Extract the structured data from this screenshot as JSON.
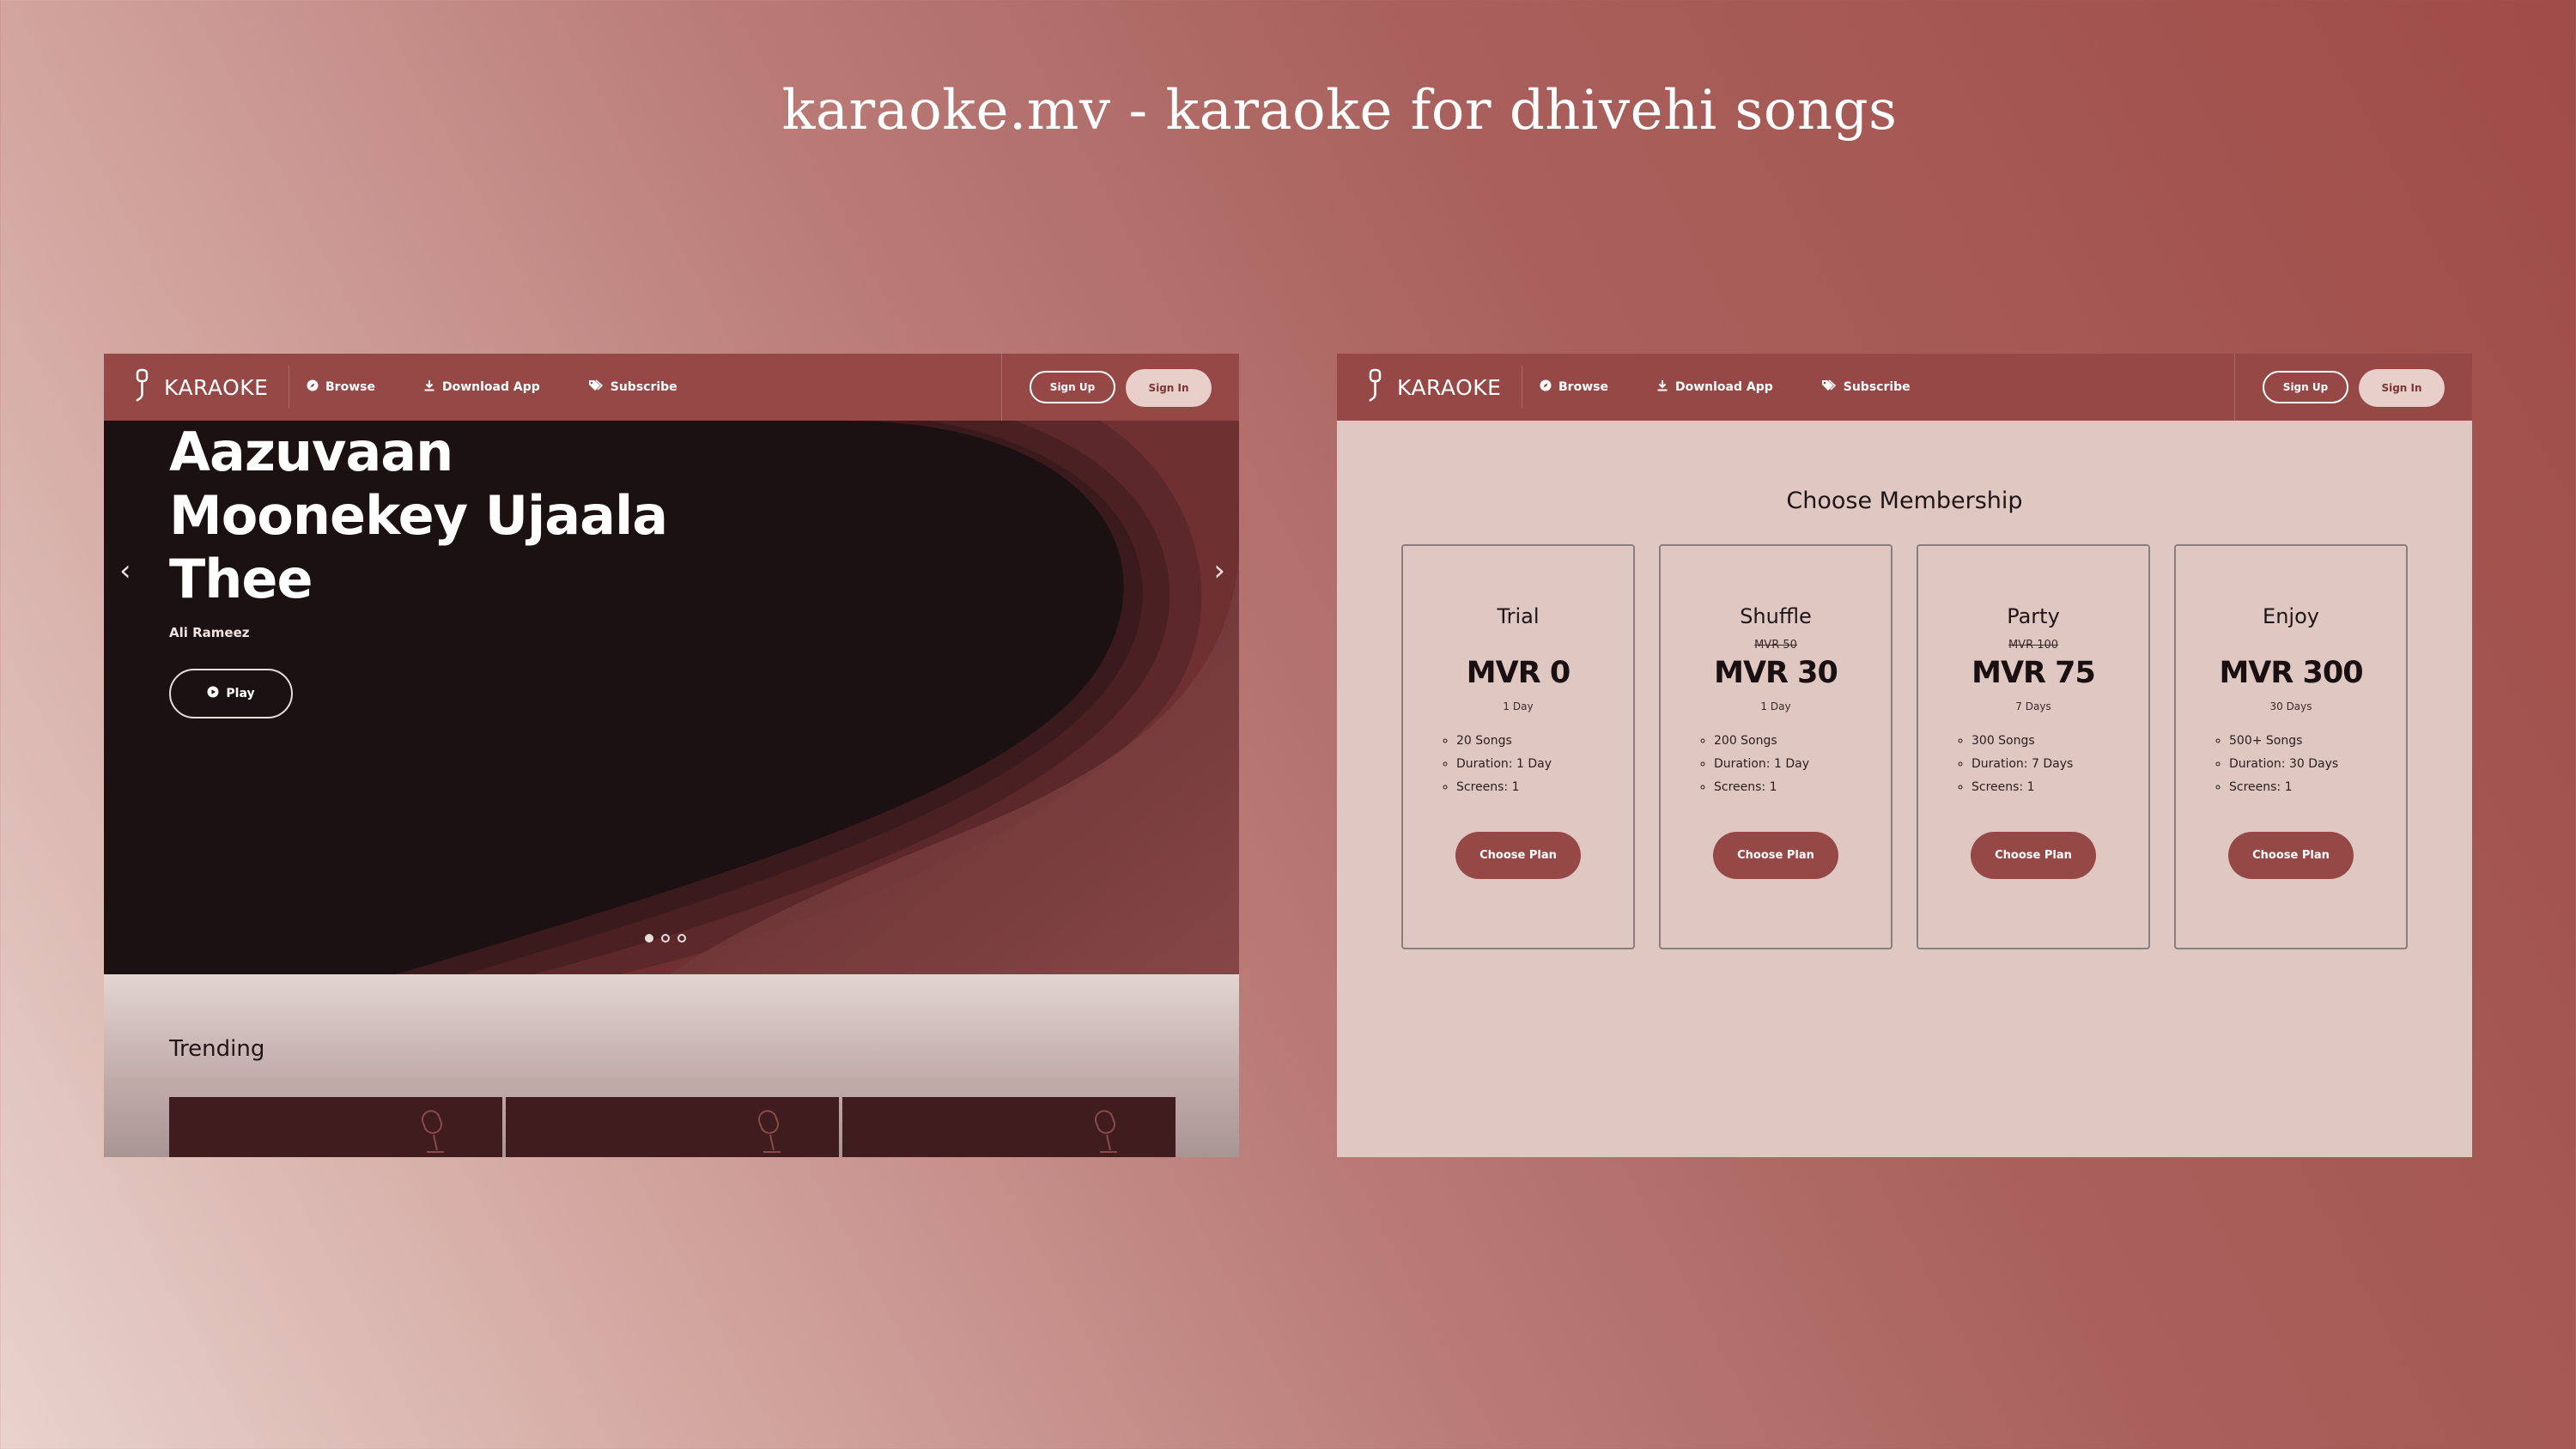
{
  "headline": "karaoke.mv - karaoke for dhivehi songs",
  "colors": {
    "brand": "#964846",
    "accent_light": "#e8cfca",
    "hero_dark": "#1b1012"
  },
  "nav": {
    "logo_text": "KARAOKE",
    "links": [
      {
        "label": "Browse",
        "icon": "compass-icon"
      },
      {
        "label": "Download App",
        "icon": "download-icon"
      },
      {
        "label": "Subscribe",
        "icon": "tags-icon"
      }
    ],
    "sign_up": "Sign Up",
    "sign_in": "Sign In"
  },
  "hero": {
    "title_lines": [
      "Aazuvaan",
      "Moonekey Ujaala",
      "Thee"
    ],
    "artist": "Ali Rameez",
    "play_label": "Play",
    "prev": "‹",
    "next": "›",
    "slide_count": 3,
    "active_slide": 1
  },
  "trending": {
    "title": "Trending",
    "card_count": 3
  },
  "membership": {
    "title": "Choose Membership",
    "plans": [
      {
        "name": "Trial",
        "old_price": "",
        "price": "MVR 0",
        "duration": "1 Day",
        "features": [
          "20 Songs",
          "Duration: 1 Day",
          "Screens: 1"
        ],
        "button": "Choose Plan"
      },
      {
        "name": "Shuffle",
        "old_price": "MVR 50",
        "price": "MVR 30",
        "duration": "1 Day",
        "features": [
          "200 Songs",
          "Duration: 1 Day",
          "Screens: 1"
        ],
        "button": "Choose Plan"
      },
      {
        "name": "Party",
        "old_price": "MVR 100",
        "price": "MVR 75",
        "duration": "7 Days",
        "features": [
          "300 Songs",
          "Duration: 7 Days",
          "Screens: 1"
        ],
        "button": "Choose Plan"
      },
      {
        "name": "Enjoy",
        "old_price": "",
        "price": "MVR 300",
        "duration": "30 Days",
        "features": [
          "500+ Songs",
          "Duration: 30 Days",
          "Screens: 1"
        ],
        "button": "Choose Plan"
      }
    ]
  }
}
